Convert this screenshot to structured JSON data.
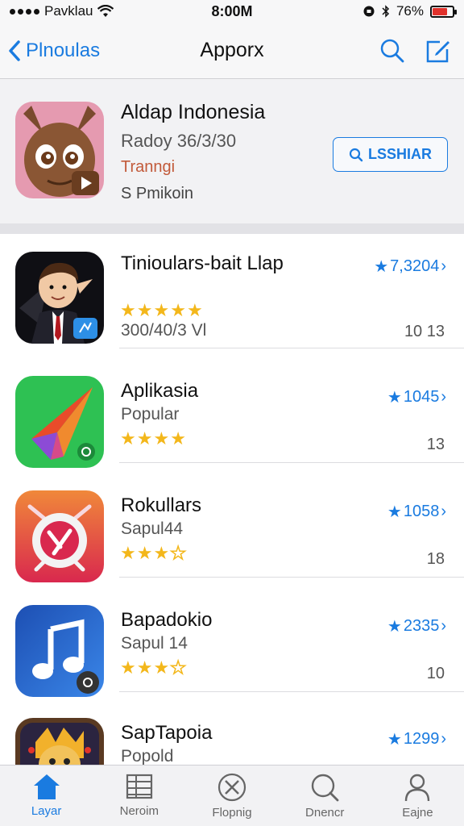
{
  "status_bar": {
    "carrier": "Pavklau",
    "time": "8:00M",
    "battery_percent": "76%",
    "battery_level": 0.76
  },
  "nav": {
    "back_label": "Plnoulas",
    "title": "Apporx"
  },
  "featured": {
    "title": "Aldap Indonesia",
    "subtitle": "Radoy 36/3/30",
    "category": "Tranngi",
    "detail": "S Pmikoin",
    "button_label": "LSSHIAR"
  },
  "apps": [
    {
      "name": "Tinioulars-bait Llap",
      "category": "",
      "stars": 5,
      "price": "7,3204",
      "size": "10 13",
      "meta": "300/40/3 Vl"
    },
    {
      "name": "Aplikasia",
      "category": "Popular",
      "stars": 4,
      "price": "1045",
      "size": "13",
      "meta": ""
    },
    {
      "name": "Rokullars",
      "category": "Sapul44",
      "stars": 3.5,
      "price": "1058",
      "size": "18",
      "meta": ""
    },
    {
      "name": "Bapadokio",
      "category": "Sapul 14",
      "stars": 3.5,
      "price": "2335",
      "size": "10",
      "meta": ""
    },
    {
      "name": "SapTapoia",
      "category": "Popold",
      "stars": 0,
      "price": "1299",
      "size": "",
      "meta": ""
    }
  ],
  "tabs": [
    {
      "label": "Layar",
      "icon": "home-icon",
      "active": true
    },
    {
      "label": "Neroim",
      "icon": "list-grid-icon",
      "active": false
    },
    {
      "label": "Flopnig",
      "icon": "compass-icon",
      "active": false
    },
    {
      "label": "Dnencr",
      "icon": "search-icon",
      "active": false
    },
    {
      "label": "Eajne",
      "icon": "person-icon",
      "active": false
    }
  ],
  "colors": {
    "accent": "#1a7be0",
    "star": "#f3b71b"
  }
}
